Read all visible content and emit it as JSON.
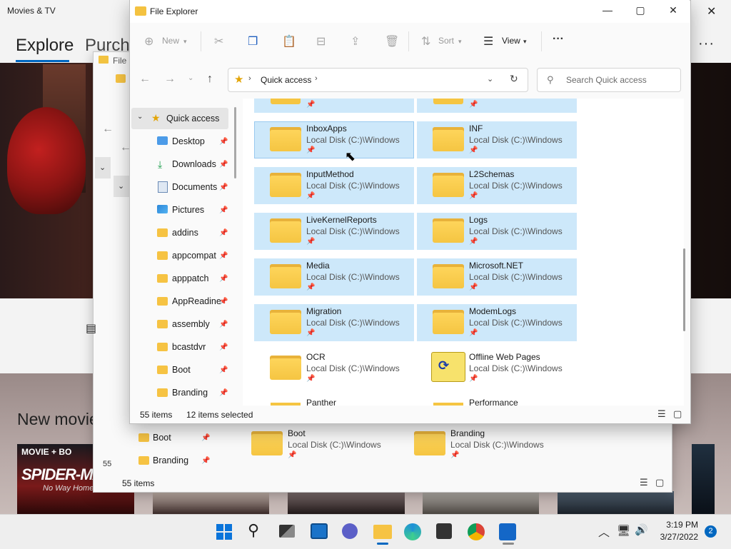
{
  "movies_app": {
    "title": "Movies & TV",
    "nav_explore": "Explore",
    "nav_purchased": "Purcha",
    "section_new_movies": "New movie",
    "poster1_tag": "MOVIE + BO",
    "poster1_title": "SPIDER-MA",
    "poster1_sub": "No Way Home"
  },
  "fe_back": {
    "title": "File E",
    "count_label": "55",
    "nav_items": [
      {
        "label": "Boot"
      },
      {
        "label": "Branding"
      }
    ],
    "tiles": [
      {
        "name": "Boot",
        "location": "Local Disk (C:)\\Windows"
      },
      {
        "name": "Branding",
        "location": "Local Disk (C:)\\Windows"
      }
    ],
    "status_items": "55 items"
  },
  "fe": {
    "title": "File Explorer",
    "toolbar": {
      "new_label": "New",
      "sort_label": "Sort",
      "view_label": "View",
      "more_label": "···"
    },
    "address": {
      "location": "Quick access",
      "search_placeholder": "Search Quick access"
    },
    "nav": {
      "quick_access": "Quick access",
      "items": [
        {
          "label": "Desktop"
        },
        {
          "label": "Downloads"
        },
        {
          "label": "Documents"
        },
        {
          "label": "Pictures"
        },
        {
          "label": "addins"
        },
        {
          "label": "appcompat"
        },
        {
          "label": "apppatch"
        },
        {
          "label": "AppReadine"
        },
        {
          "label": "assembly"
        },
        {
          "label": "bcastdvr"
        },
        {
          "label": "Boot"
        },
        {
          "label": "Branding"
        }
      ]
    },
    "tiles": [
      {
        "name": "InboxApps",
        "location": "Local Disk (C:)\\Windows"
      },
      {
        "name": "INF",
        "location": "Local Disk (C:)\\Windows"
      },
      {
        "name": "InputMethod",
        "location": "Local Disk (C:)\\Windows"
      },
      {
        "name": "L2Schemas",
        "location": "Local Disk (C:)\\Windows"
      },
      {
        "name": "LiveKernelReports",
        "location": "Local Disk (C:)\\Windows"
      },
      {
        "name": "Logs",
        "location": "Local Disk (C:)\\Windows"
      },
      {
        "name": "Media",
        "location": "Local Disk (C:)\\Windows"
      },
      {
        "name": "Microsoft.NET",
        "location": "Local Disk (C:)\\Windows"
      },
      {
        "name": "Migration",
        "location": "Local Disk (C:)\\Windows"
      },
      {
        "name": "ModemLogs",
        "location": "Local Disk (C:)\\Windows"
      },
      {
        "name": "OCR",
        "location": "Local Disk (C:)\\Windows"
      },
      {
        "name": "Offline Web Pages",
        "location": "Local Disk (C:)\\Windows"
      },
      {
        "name": "Panther",
        "location": ""
      },
      {
        "name": "Performance",
        "location": ""
      }
    ],
    "status": {
      "items": "55 items",
      "selected": "12 items selected"
    }
  },
  "taskbar": {
    "time": "3:19 PM",
    "date": "3/27/2022",
    "notifications": "2"
  },
  "colors": {
    "accent": "#0067c0",
    "selection": "#cde8fa",
    "folder": "#f6c343"
  }
}
